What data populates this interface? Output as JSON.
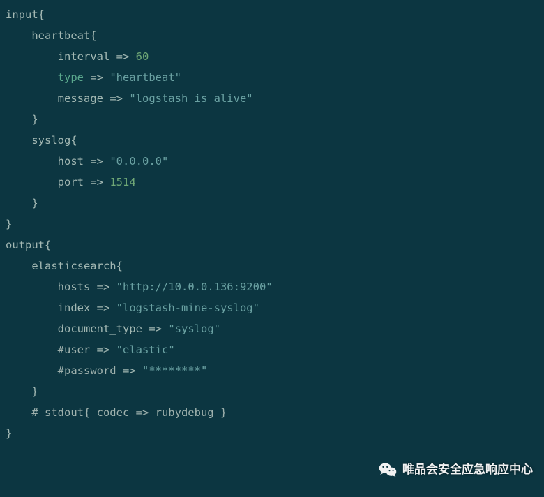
{
  "code": {
    "lines": [
      {
        "indent": 0,
        "segs": [
          {
            "t": "input{",
            "c": "kw"
          }
        ]
      },
      {
        "indent": 1,
        "segs": [
          {
            "t": "heartbeat{",
            "c": "kw"
          }
        ]
      },
      {
        "indent": 2,
        "segs": [
          {
            "t": "interval ",
            "c": "kw"
          },
          {
            "t": "=>",
            "c": "op"
          },
          {
            "t": " ",
            "c": "kw"
          },
          {
            "t": "60",
            "c": "num"
          }
        ]
      },
      {
        "indent": 2,
        "segs": [
          {
            "t": "type",
            "c": "key"
          },
          {
            "t": " ",
            "c": "kw"
          },
          {
            "t": "=>",
            "c": "op"
          },
          {
            "t": " ",
            "c": "kw"
          },
          {
            "t": "\"heartbeat\"",
            "c": "str"
          }
        ]
      },
      {
        "indent": 2,
        "segs": [
          {
            "t": "message ",
            "c": "kw"
          },
          {
            "t": "=>",
            "c": "op"
          },
          {
            "t": " ",
            "c": "kw"
          },
          {
            "t": "\"logstash is alive\"",
            "c": "str"
          }
        ]
      },
      {
        "indent": 1,
        "segs": [
          {
            "t": "}",
            "c": "kw"
          }
        ]
      },
      {
        "indent": 0,
        "segs": [
          {
            "t": "",
            "c": "kw"
          }
        ]
      },
      {
        "indent": 1,
        "segs": [
          {
            "t": "syslog{",
            "c": "kw"
          }
        ]
      },
      {
        "indent": 2,
        "segs": [
          {
            "t": "host ",
            "c": "kw"
          },
          {
            "t": "=>",
            "c": "op"
          },
          {
            "t": " ",
            "c": "kw"
          },
          {
            "t": "\"0.0.0.0\"",
            "c": "str"
          }
        ]
      },
      {
        "indent": 2,
        "segs": [
          {
            "t": "port ",
            "c": "kw"
          },
          {
            "t": "=>",
            "c": "op"
          },
          {
            "t": " ",
            "c": "kw"
          },
          {
            "t": "1514",
            "c": "num"
          }
        ]
      },
      {
        "indent": 1,
        "segs": [
          {
            "t": "}",
            "c": "kw"
          }
        ]
      },
      {
        "indent": 0,
        "segs": [
          {
            "t": "}",
            "c": "kw"
          }
        ]
      },
      {
        "indent": 0,
        "segs": [
          {
            "t": "",
            "c": "kw"
          }
        ]
      },
      {
        "indent": 0,
        "segs": [
          {
            "t": "output{",
            "c": "kw"
          }
        ]
      },
      {
        "indent": 1,
        "segs": [
          {
            "t": "elasticsearch{",
            "c": "kw"
          }
        ]
      },
      {
        "indent": 2,
        "segs": [
          {
            "t": "hosts ",
            "c": "kw"
          },
          {
            "t": "=>",
            "c": "op"
          },
          {
            "t": " ",
            "c": "kw"
          },
          {
            "t": "\"http://10.0.0.136:9200\"",
            "c": "str"
          }
        ]
      },
      {
        "indent": 2,
        "segs": [
          {
            "t": "index ",
            "c": "kw"
          },
          {
            "t": "=>",
            "c": "op"
          },
          {
            "t": " ",
            "c": "kw"
          },
          {
            "t": "\"logstash-mine-syslog\"",
            "c": "str"
          }
        ]
      },
      {
        "indent": 2,
        "segs": [
          {
            "t": "document_type ",
            "c": "kw"
          },
          {
            "t": "=>",
            "c": "op"
          },
          {
            "t": " ",
            "c": "kw"
          },
          {
            "t": "\"syslog\"",
            "c": "str"
          }
        ]
      },
      {
        "indent": 2,
        "segs": [
          {
            "t": "#user ",
            "c": "cmt"
          },
          {
            "t": "=>",
            "c": "op"
          },
          {
            "t": " ",
            "c": "kw"
          },
          {
            "t": "\"elastic\"",
            "c": "str"
          }
        ]
      },
      {
        "indent": 2,
        "segs": [
          {
            "t": "#password ",
            "c": "cmt"
          },
          {
            "t": "=>",
            "c": "op"
          },
          {
            "t": " ",
            "c": "kw"
          },
          {
            "t": "\"********\"",
            "c": "str"
          }
        ]
      },
      {
        "indent": 1,
        "segs": [
          {
            "t": "}",
            "c": "kw"
          }
        ]
      },
      {
        "indent": 1,
        "segs": [
          {
            "t": "# stdout{ codec => rubydebug }",
            "c": "cmt"
          }
        ]
      },
      {
        "indent": 0,
        "segs": [
          {
            "t": "}",
            "c": "kw"
          }
        ]
      }
    ],
    "indent_unit": "    "
  },
  "watermark": {
    "text": "唯品会安全应急响应中心",
    "icon": "wechat-icon"
  }
}
